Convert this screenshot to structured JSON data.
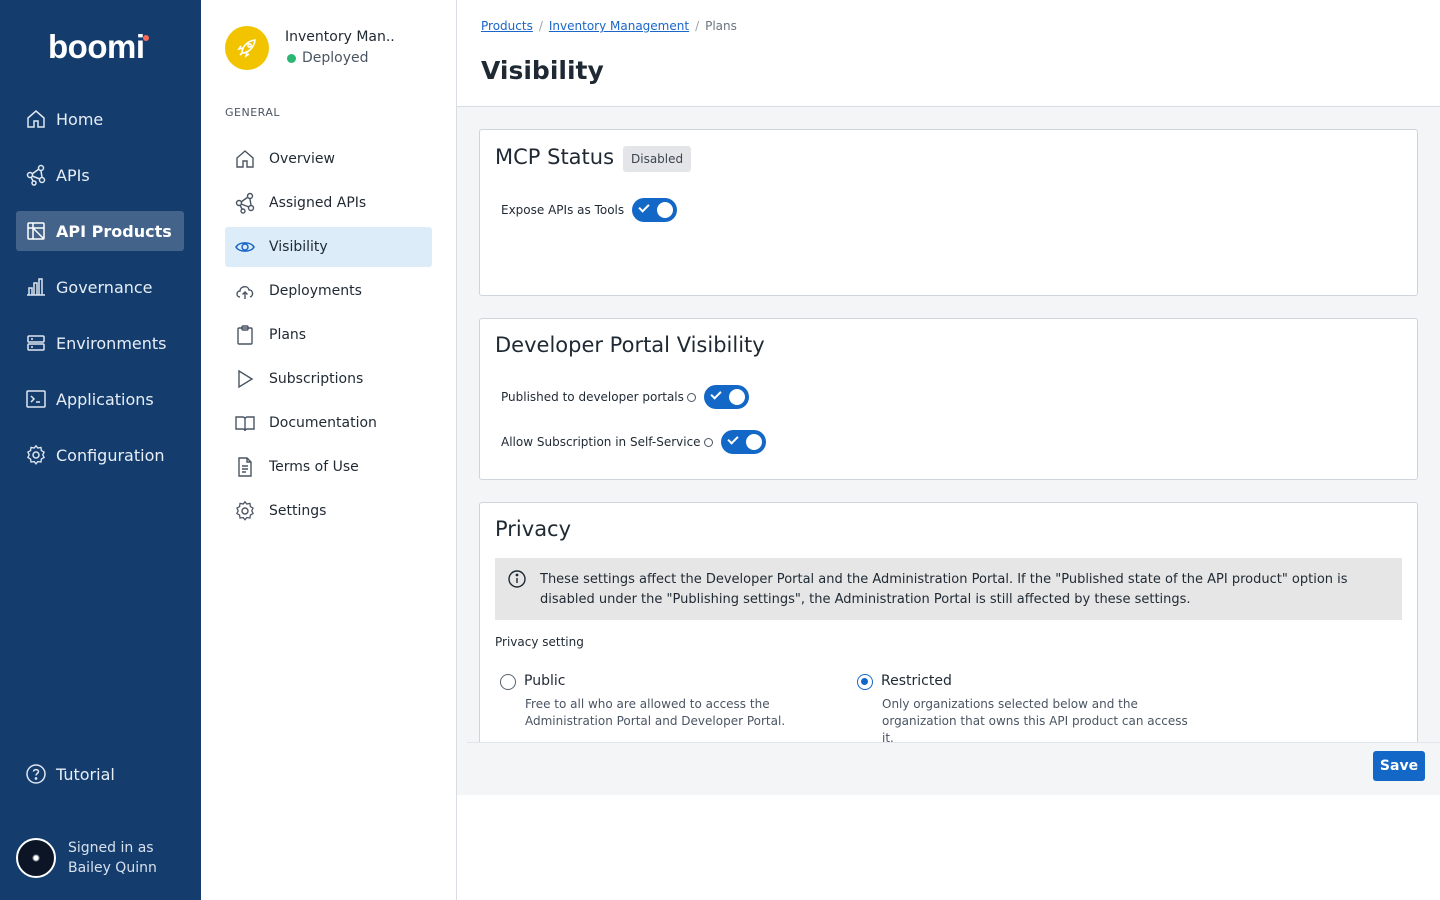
{
  "brand": {
    "logo": "boomi",
    "accent": "#143d6e",
    "dot_color": "#ff6b5b"
  },
  "nav": {
    "items": [
      {
        "label": "Home",
        "icon": "home-icon"
      },
      {
        "label": "APIs",
        "icon": "api-network-icon"
      },
      {
        "label": "API Products",
        "icon": "api-products-icon",
        "active": true
      },
      {
        "label": "Governance",
        "icon": "bar-chart-icon"
      },
      {
        "label": "Environments",
        "icon": "server-icon"
      },
      {
        "label": "Applications",
        "icon": "terminal-icon"
      },
      {
        "label": "Configuration",
        "icon": "gear-icon"
      }
    ],
    "tutorial": "Tutorial",
    "signed_in_label": "Signed in as",
    "user_name": "Bailey Quinn"
  },
  "product": {
    "name": "Inventory Man..",
    "status": "Deployed",
    "status_color": "#2bb673"
  },
  "side": {
    "section": "GENERAL",
    "items": [
      {
        "label": "Overview",
        "icon": "home-icon"
      },
      {
        "label": "Assigned APIs",
        "icon": "api-network-icon"
      },
      {
        "label": "Visibility",
        "icon": "eye-icon",
        "active": true
      },
      {
        "label": "Deployments",
        "icon": "cloud-upload-icon"
      },
      {
        "label": "Plans",
        "icon": "clipboard-icon"
      },
      {
        "label": "Subscriptions",
        "icon": "play-icon"
      },
      {
        "label": "Documentation",
        "icon": "book-icon"
      },
      {
        "label": "Terms of Use",
        "icon": "document-icon"
      },
      {
        "label": "Settings",
        "icon": "gear-icon"
      }
    ]
  },
  "breadcrumb": [
    "Products",
    "Inventory Management",
    "Plans"
  ],
  "page_title": "Visibility",
  "mcp": {
    "title": "MCP Status",
    "badge": "Disabled",
    "toggle_label": "Expose APIs as Tools",
    "toggle_on": true
  },
  "portal": {
    "title": "Developer Portal Visibility",
    "published_label": "Published to developer portals",
    "published_on": true,
    "self_service_label": "Allow Subscription in Self-Service",
    "self_service_on": true
  },
  "privacy": {
    "title": "Privacy",
    "notice": "These settings affect the Developer Portal and the Administration Portal. If the \"Published state of the API product\" option is disabled under the \"Publishing settings\", the Administration Portal is still affected by these settings.",
    "setting_label": "Privacy setting",
    "options": [
      {
        "label": "Public",
        "desc": "Free to all who are allowed to access the Administration Portal and Developer Portal.",
        "selected": false
      },
      {
        "label": "Restricted",
        "desc": "Only organizations selected below and the organization that owns this API product can access it.",
        "selected": true
      }
    ]
  },
  "save_label": "Save"
}
